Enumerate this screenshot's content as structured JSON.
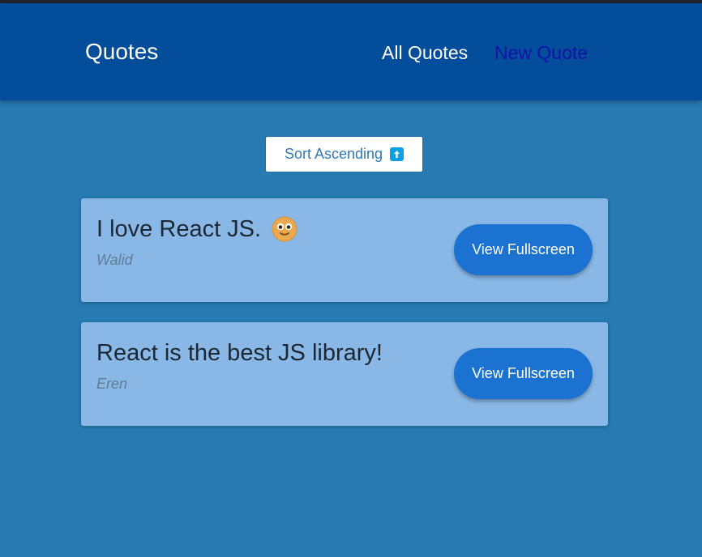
{
  "header": {
    "logo": "Quotes",
    "nav": {
      "all_quotes": "All Quotes",
      "new_quote": "New Quote"
    }
  },
  "toolbar": {
    "sort_label": "Sort Ascending",
    "sort_icon": "arrow-up-icon"
  },
  "quotes": [
    {
      "text": "I love React JS.",
      "emoji": "smiling-face-icon",
      "author": "Walid",
      "button_label": "View Fullscreen"
    },
    {
      "text": "React is the best JS library!",
      "author": "Eren",
      "button_label": "View Fullscreen"
    }
  ],
  "colors": {
    "header_bg": "#034d9a",
    "page_bg": "#277bb2",
    "card_bg": "#8ab8e6",
    "button_bg": "#1c72d0",
    "active_nav": "#1212a6"
  }
}
